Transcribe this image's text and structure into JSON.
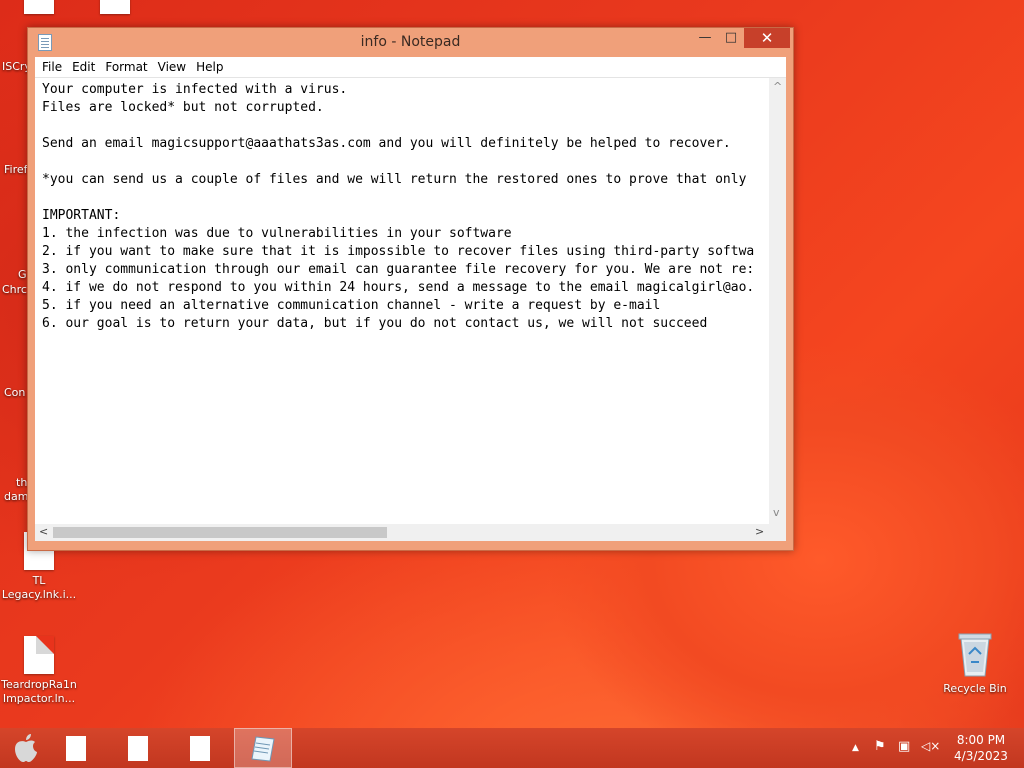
{
  "desktop": {
    "icons": [
      {
        "label": "TL\nLegacy.lnk.i..."
      },
      {
        "label": "TeardropRa1n\nImpactor.ln..."
      },
      {
        "label": "Recycle Bin"
      }
    ],
    "partial_labels": [
      "ISCry",
      "Firef",
      "G",
      "Chrc",
      "Con",
      "th",
      "dam"
    ]
  },
  "notepad": {
    "title": "info - Notepad",
    "buttons": {
      "minimize": "—",
      "maximize": "□",
      "close": "✕"
    },
    "menu": [
      "File",
      "Edit",
      "Format",
      "View",
      "Help"
    ],
    "content_lines": [
      "Your computer is infected with a virus.",
      "Files are locked* but not corrupted.",
      "",
      "Send an email magicsupport@aaathats3as.com and you will definitely be helped to recover.",
      "",
      "*you can send us a couple of files and we will return the restored ones to prove that only",
      "",
      "IMPORTANT:",
      "1. the infection was due to vulnerabilities in your software",
      "2. if you want to make sure that it is impossible to recover files using third-party softwa",
      "3. only communication through our email can guarantee file recovery for you. We are not re:",
      "4. if we do not respond to you within 24 hours, send a message to the email magicalgirl@ao.",
      "5. if you need an alternative communication channel - write a request by e-mail",
      "6. our goal is to return your data, but if you do not contact us, we will not succeed"
    ],
    "scrollbar": {
      "up": "^",
      "down": "v",
      "left": "<",
      "right": ">"
    }
  },
  "taskbar": {
    "items": [
      "start-button",
      "file",
      "file",
      "file",
      "notepad"
    ],
    "clock": {
      "time": "8:00 PM",
      "date": "4/3/2023"
    },
    "tray": {
      "chevron": "▲",
      "flag": "⚑",
      "network": "▣",
      "volume": "◁×"
    }
  },
  "colors": {
    "accent": "#e8331c",
    "close": "#c7402a",
    "window_frame": "#f0a07a"
  }
}
